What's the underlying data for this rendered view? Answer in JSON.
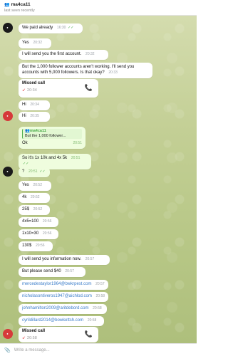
{
  "header": {
    "title": "ma4ca11",
    "title_emoji": "👥",
    "status": "last seen recently"
  },
  "messages": [
    {
      "text": "We paid already",
      "time": "16:30",
      "dir": "out"
    },
    {
      "text": "Yes",
      "time": "20:32",
      "dir": "in"
    },
    {
      "text": "I will send you the first account.",
      "time": "20:32",
      "dir": "in"
    },
    {
      "text": "But the 1,000 follower accounts aren't working. I'll send you accounts with 5,000 followers. Is that okay?",
      "time": "20:33",
      "dir": "in"
    },
    {
      "title": "Missed call",
      "time": "20:34",
      "dir": "in",
      "type": "call"
    },
    {
      "text": "Hi",
      "time": "20:34",
      "dir": "in"
    },
    {
      "text": "Hi",
      "time": "20:35",
      "dir": "in"
    },
    {
      "quote_name": "ma4ca11",
      "quote_text": "But the 1,000 follower...",
      "text": "Ok",
      "time": "20:51",
      "dir": "out"
    },
    {
      "text": "So it's 1x 10k and 4x 5k",
      "time": "20:51",
      "dir": "out"
    },
    {
      "text": "?",
      "time": "20:51",
      "dir": "out"
    },
    {
      "text": "Yes",
      "time": "20:52",
      "dir": "in"
    },
    {
      "text": "4k",
      "time": "20:52",
      "dir": "in"
    },
    {
      "text": "25$",
      "time": "20:52",
      "dir": "in"
    },
    {
      "text": "4x5=100",
      "time": "20:56",
      "dir": "in"
    },
    {
      "text": "1x10=30",
      "time": "20:56",
      "dir": "in"
    },
    {
      "text": "130$",
      "time": "20:56",
      "dir": "in"
    },
    {
      "text": "I will send you information now.",
      "time": "20:57",
      "dir": "in"
    },
    {
      "text": "But please send $40",
      "time": "20:57",
      "dir": "in"
    },
    {
      "text": "mercedestaylor1964@bwkrpest.com",
      "time": "20:57",
      "dir": "in",
      "link": true
    },
    {
      "text": "nicholasontiveros1947@aichlod.com",
      "time": "20:58",
      "dir": "in",
      "link": true
    },
    {
      "text": "johnhamilton2009@aritdebord.com",
      "time": "20:58",
      "dir": "in",
      "link": true
    },
    {
      "text": "cyrildillard2014@bowkettsh.com",
      "time": "20:58",
      "dir": "in",
      "link": true
    },
    {
      "title": "Missed call",
      "time": "20:58",
      "dir": "in",
      "type": "call"
    }
  ],
  "composer": {
    "placeholder": "Write a message..."
  }
}
